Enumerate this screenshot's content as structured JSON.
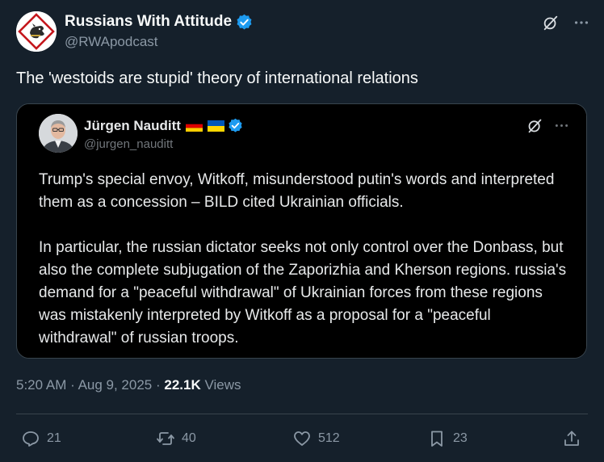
{
  "author": {
    "display_name": "Russians With Attitude",
    "handle": "@RWApodcast",
    "verified": true,
    "avatar_icon": "dog-diamond-logo-icon"
  },
  "tweet": {
    "text": "The 'westoids are stupid' theory of international relations"
  },
  "quoted_tweet": {
    "display_name": "Jürgen Nauditt",
    "handle": "@jurgen_nauditt",
    "flags": [
      "germany-flag-icon",
      "ukraine-flag-icon"
    ],
    "verified": true,
    "paragraph_1": "Trump's special envoy, Witkoff, misunderstood putin's words and interpreted them as a concession – BILD cited Ukrainian officials.",
    "paragraph_2": "In particular, the russian dictator seeks not only control over the Donbass, but also the complete subjugation of the Zaporizhia and Kherson regions. russia's demand for a \"peaceful withdrawal\" of Ukrainian forces from these regions was mistakenly interpreted by Witkoff as a proposal for a \"peaceful withdrawal\" of russian troops."
  },
  "meta": {
    "time": "5:20 AM",
    "date": "Aug 9, 2025",
    "views_count": "22.1K",
    "views_label": "Views"
  },
  "actions": {
    "replies": "21",
    "reposts": "40",
    "likes": "512",
    "bookmarks": "23"
  },
  "colors": {
    "background": "#15202b",
    "quote_background": "#000000",
    "verified": "#1d9bf0",
    "muted_text": "#8b98a5",
    "border": "#38444d"
  }
}
